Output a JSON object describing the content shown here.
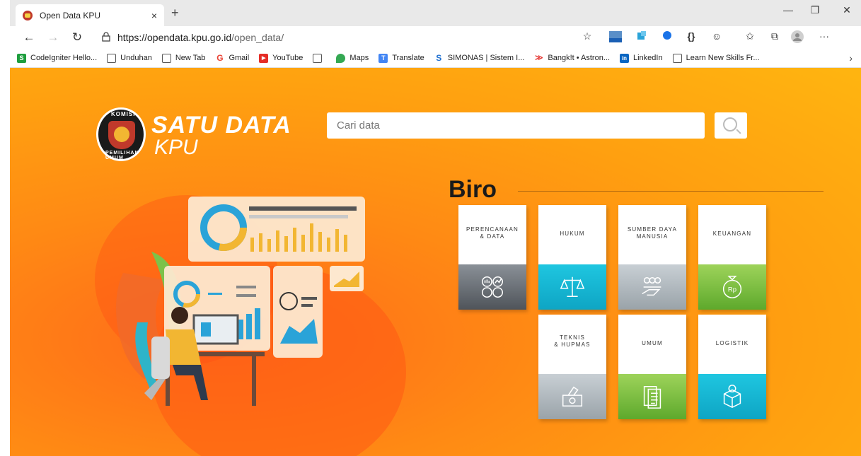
{
  "browser": {
    "tab_title": "Open Data KPU",
    "tab_close": "×",
    "new_tab": "+",
    "url_host": "https://opendata.kpu.go.id",
    "url_path": "/open_data/",
    "window_controls": [
      "—",
      "❐",
      "✕"
    ]
  },
  "bookmarks": [
    {
      "label": "CodeIgniter Hello...",
      "icon": "S",
      "color": "#1e9e3e"
    },
    {
      "label": "Unduhan",
      "icon": "page",
      "color": "#ffffff"
    },
    {
      "label": "New Tab",
      "icon": "page",
      "color": "#ffffff"
    },
    {
      "label": "Gmail",
      "icon": "G",
      "color": "#ea4335"
    },
    {
      "label": "YouTube",
      "icon": "▶",
      "color": "#e52d27"
    },
    {
      "label": "",
      "icon": "page",
      "color": "#ffffff"
    },
    {
      "label": "Maps",
      "icon": "pin",
      "color": "#34a853"
    },
    {
      "label": "Translate",
      "icon": "T",
      "color": "#4285f4"
    },
    {
      "label": "SIMONAS | Sistem I...",
      "icon": "S",
      "color": "#1d6fd1"
    },
    {
      "label": "Bangk!t • Astron...",
      "icon": "B",
      "color": "#e53935"
    },
    {
      "label": "LinkedIn",
      "icon": "in",
      "color": "#0a66c2"
    },
    {
      "label": "Learn New Skills Fr...",
      "icon": "page",
      "color": "#ffffff"
    }
  ],
  "bookmarks_more": "›",
  "site": {
    "emblem_top": "KOMISI",
    "emblem_bottom": "PEMILIHAN UMUM",
    "brand_line1": "SATU DATA",
    "brand_line2": "KPU",
    "search_placeholder": "Cari data",
    "section_title": "Biro",
    "colors": {
      "accent_orange": "#ff8a14",
      "card_cyan": "#0ea5c4",
      "card_green": "#5ea92c",
      "card_dark": "#4f545a"
    }
  },
  "cards": [
    {
      "line1": "PERENCANAAN",
      "line2": "& DATA",
      "style": "dark",
      "icon": "data-analytics-icon"
    },
    {
      "line1": "HUKUM",
      "line2": "",
      "style": "cyan",
      "icon": "scales-icon"
    },
    {
      "line1": "SUMBER DAYA",
      "line2": "MANUSIA",
      "style": "silver",
      "icon": "people-hand-icon"
    },
    {
      "line1": "KEUANGAN",
      "line2": "",
      "style": "green",
      "icon": "money-bag-icon"
    },
    {
      "line1": "TEKNIS",
      "line2": "& HUPMAS",
      "style": "silver",
      "icon": "ballot-box-icon"
    },
    {
      "line1": "UMUM",
      "line2": "",
      "style": "green",
      "icon": "documents-icon"
    },
    {
      "line1": "LOGISTIK",
      "line2": "",
      "style": "cyan",
      "icon": "package-icon"
    }
  ]
}
